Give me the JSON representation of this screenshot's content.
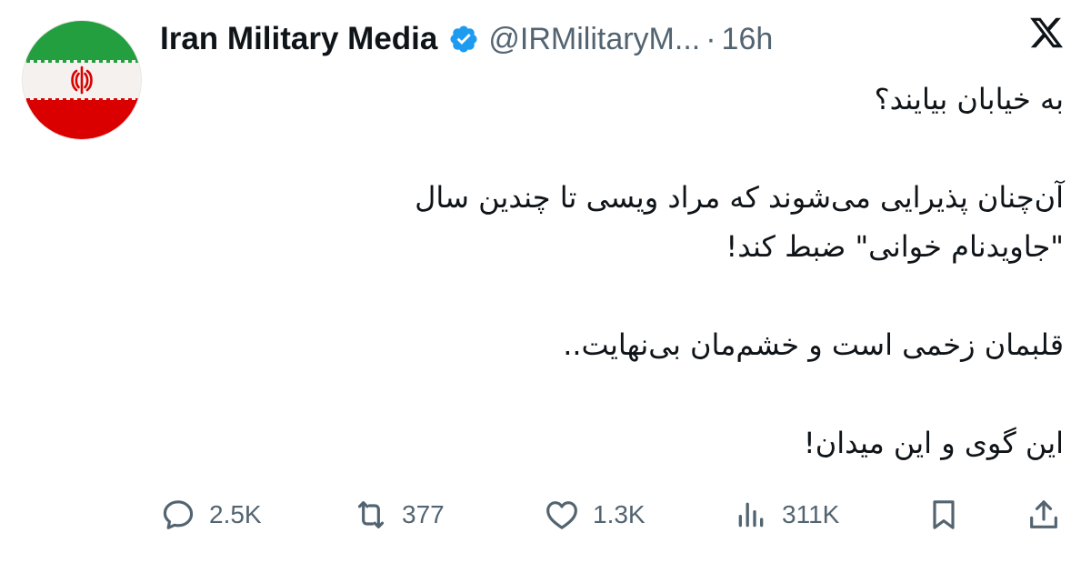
{
  "author": {
    "name": "Iran Military Media",
    "handle": "@IRMilitaryM...",
    "separator": "·",
    "time": "16h",
    "verified": true
  },
  "tweet": {
    "lines": [
      "به خیابان بیایند؟",
      "",
      "آن‌چنان پذیرایی می‌شوند که مراد ویسی تا چندین سال",
      "\"جاویدنام خوانی\" ضبط کند!",
      "",
      "قلبمان زخمی است و خشم‌مان بی‌نهایت..",
      "",
      "این گوی و این میدان!"
    ]
  },
  "actions": {
    "replies": "2.5K",
    "reposts": "377",
    "likes": "1.3K",
    "views": "311K"
  },
  "icons": {
    "reply": "speech-bubble-icon",
    "repost": "repost-arrows-icon",
    "like": "heart-icon",
    "views": "bar-chart-icon",
    "bookmark": "bookmark-icon",
    "share": "share-upload-icon",
    "platform": "x-logo-icon"
  },
  "colors": {
    "text": "#0f1419",
    "muted": "#536471",
    "verified": "#1d9bf0",
    "flag_green": "#239f40",
    "flag_red": "#da0000"
  }
}
